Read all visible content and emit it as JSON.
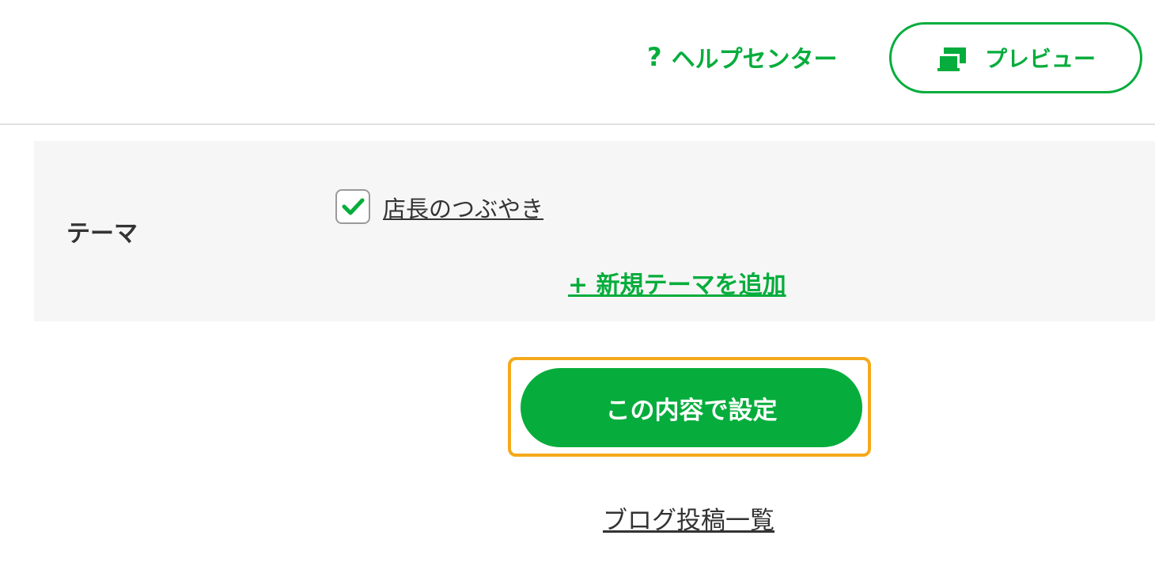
{
  "header": {
    "help_icon": "question-mark-icon",
    "help_icon_glyph": "?",
    "help_label": "ヘルプセンター",
    "preview_icon": "preview-window-icon",
    "preview_label": "プレビュー"
  },
  "form": {
    "theme_label": "テーマ",
    "theme_options": [
      {
        "label": "店長のつぶやき",
        "checked": true
      }
    ],
    "add_theme_label": "+ 新規テーマを追加"
  },
  "actions": {
    "submit_label": "この内容で設定",
    "list_link_label": "ブログ投稿一覧"
  },
  "colors": {
    "accent": "#06ad3c",
    "focus_outline": "#f5a91b",
    "panel_bg": "#f6f6f6",
    "text": "#333333"
  }
}
